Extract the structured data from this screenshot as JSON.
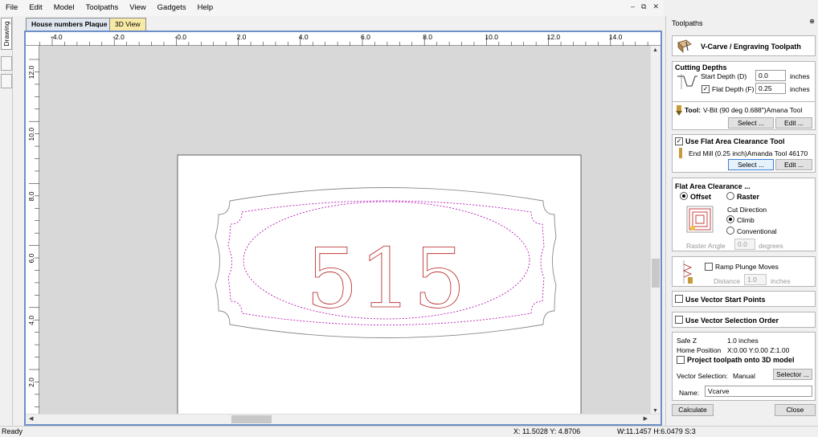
{
  "menu": [
    "File",
    "Edit",
    "Model",
    "Toolpaths",
    "View",
    "Gadgets",
    "Help"
  ],
  "mdi_controls": [
    "–",
    "⧉",
    "✕"
  ],
  "left_strip": {
    "drawing_tab": "Drawing"
  },
  "tabs": {
    "active": "House numbers Plaque",
    "inactive": "3D View"
  },
  "ruler": {
    "top_labels": [
      "-4.0",
      "-2.0",
      "-0.0",
      "2.0",
      "4.0",
      "6.0",
      "8.0",
      "10.0",
      "12.0",
      "14.0"
    ],
    "left_labels": [
      "12.0",
      "10.0",
      "8.0",
      "6.0",
      "4.0",
      "2.0"
    ]
  },
  "drawing": {
    "house_number": "515",
    "colors": {
      "outline": "#8a8a8a",
      "offset_dashed": "#b000b0",
      "vectors": "#b52020",
      "background": "#d8d8d8"
    }
  },
  "status": {
    "ready": "Ready",
    "xy": "X: 11.5028 Y: 4.8706",
    "size": "W:11.1457  H:6.0479  S:3"
  },
  "panel": {
    "title": "Toolpaths",
    "pin": "⊕",
    "header": "V-Carve / Engraving Toolpath",
    "cutting": {
      "title": "Cutting Depths",
      "start_label": "Start Depth (D)",
      "start_value": "0.0",
      "start_unit": "inches",
      "flat_label": "Flat Depth (F)",
      "flat_value": "0.25",
      "flat_unit": "inches",
      "flat_checked": "✓"
    },
    "tool": {
      "label": "Tool:",
      "name": "V-Bit (90 deg 0.688\")Amana Tool",
      "select": "Select ...",
      "edit": "Edit ..."
    },
    "flat_clear": {
      "label": "Use Flat Area Clearance Tool",
      "checked": "✓",
      "tool": "End Mill (0.25 inch)Amanda Tool 46170",
      "select": "Select ...",
      "edit": "Edit ..."
    },
    "area": {
      "title": "Flat Area Clearance ...",
      "offset": "Offset",
      "raster": "Raster",
      "cut_direction": "Cut Direction",
      "climb": "Climb",
      "conventional": "Conventional",
      "raster_angle_label": "Raster Angle",
      "raster_angle_value": "0.0",
      "raster_angle_unit": "degrees"
    },
    "ramp": {
      "label": "Ramp Plunge Moves",
      "distance_label": "Distance",
      "distance_value": "1.0",
      "distance_unit": "inches"
    },
    "vector_start": "Use Vector Start Points",
    "vector_order": "Use Vector Selection Order",
    "misc": {
      "safe_z_label": "Safe Z",
      "safe_z_value": "1.0 inches",
      "home_label": "Home Position",
      "home_value": "X:0.00 Y:0.00 Z:1.00",
      "project_label": "Project toolpath onto 3D model",
      "vector_selection_label": "Vector Selection:",
      "vector_selection_value": "Manual",
      "selector_button": "Selector ...",
      "name_label": "Name:",
      "name_value": "Vcarve"
    },
    "calculate": "Calculate",
    "close": "Close"
  }
}
